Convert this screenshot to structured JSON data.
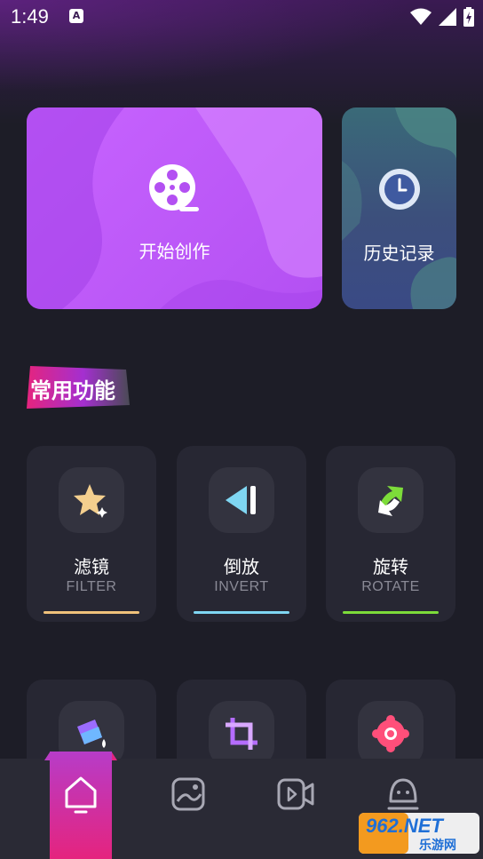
{
  "status_bar": {
    "time": "1:49",
    "notification_letter": "A"
  },
  "cards": {
    "create": {
      "label": "开始创作",
      "icon": "film-reel-icon"
    },
    "history": {
      "label": "历史记录",
      "icon": "clock-icon"
    }
  },
  "section": {
    "title": "常用功能"
  },
  "features": [
    {
      "cn": "滤镜",
      "en": "FILTER",
      "icon": "star-sparkle-icon",
      "accent": "#f0c27b"
    },
    {
      "cn": "倒放",
      "en": "INVERT",
      "icon": "rewind-icon",
      "accent": "#7fd6f2"
    },
    {
      "cn": "旋转",
      "en": "ROTATE",
      "icon": "rotate-arrows-icon",
      "accent": "#7ddc3a"
    },
    {
      "cn": "",
      "en": "",
      "icon": "paint-bucket-icon",
      "accent": "#6fb7ff"
    },
    {
      "cn": "",
      "en": "",
      "icon": "crop-icon",
      "accent": "#b56cff"
    },
    {
      "cn": "",
      "en": "",
      "icon": "gear-flower-icon",
      "accent": "#ff4f7a"
    }
  ],
  "nav": [
    {
      "name": "home",
      "icon": "home-icon",
      "active": true
    },
    {
      "name": "gallery",
      "icon": "image-icon",
      "active": false
    },
    {
      "name": "video",
      "icon": "video-icon",
      "active": false
    },
    {
      "name": "profile",
      "icon": "user-icon",
      "active": false
    }
  ],
  "watermark": {
    "brand": "962.NET",
    "sub": "乐游网"
  }
}
